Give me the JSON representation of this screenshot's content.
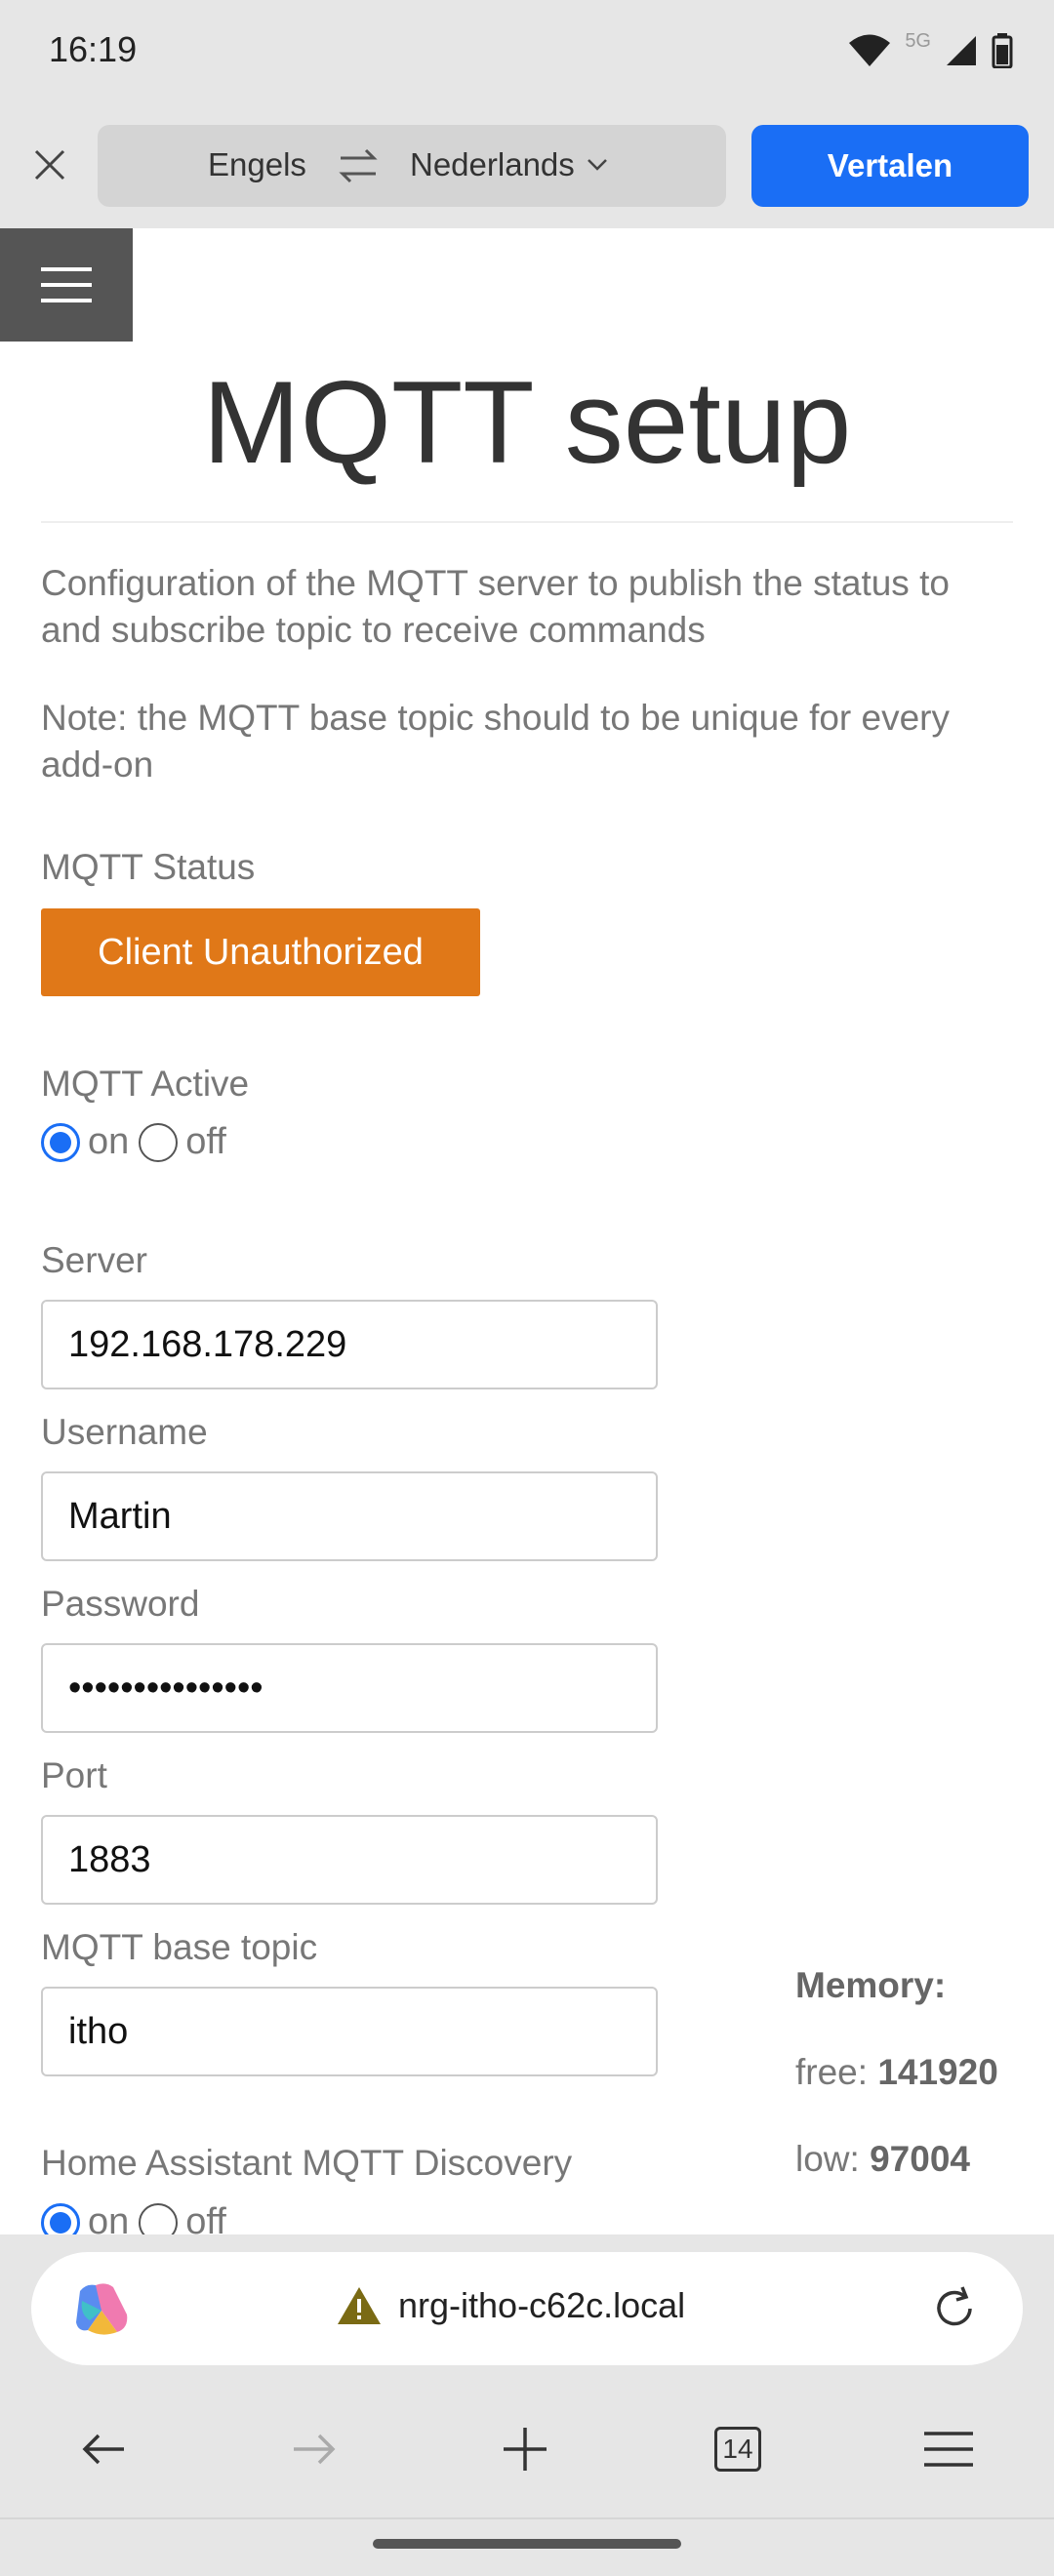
{
  "status_bar": {
    "time": "16:19",
    "network": "5G"
  },
  "translate_bar": {
    "source_lang": "Engels",
    "target_lang": "Nederlands",
    "translate_label": "Vertalen"
  },
  "page": {
    "title": "MQTT setup",
    "description": "Configuration of the MQTT server to publish the status to and subscribe topic to receive commands",
    "note": "Note: the MQTT base topic should to be unique for every add-on",
    "mqtt_status_label": "MQTT Status",
    "mqtt_status_value": "Client Unauthorized",
    "mqtt_status_color": "#e07818",
    "mqtt_active_label": "MQTT Active",
    "mqtt_active": "on",
    "on_label": "on",
    "off_label": "off",
    "server_label": "Server",
    "server_value": "192.168.178.229",
    "username_label": "Username",
    "username_value": "Martin",
    "password_label": "Password",
    "password_value": "•••••••••••••••",
    "port_label": "Port",
    "port_value": "1883",
    "base_topic_label": "MQTT base topic",
    "base_topic_value": "itho",
    "ha_discovery_label": "Home Assistant MQTT Discovery",
    "ha_discovery": "on"
  },
  "memory": {
    "title": "Memory:",
    "free_label": "free:",
    "free_value": "141920",
    "low_label": "low:",
    "low_value": "97004"
  },
  "address_bar": {
    "url": "nrg-itho-c62c.local"
  },
  "bottom_nav": {
    "tab_count": "14"
  },
  "colors": {
    "accent": "#1a6ef5",
    "warning": "#e07818"
  }
}
